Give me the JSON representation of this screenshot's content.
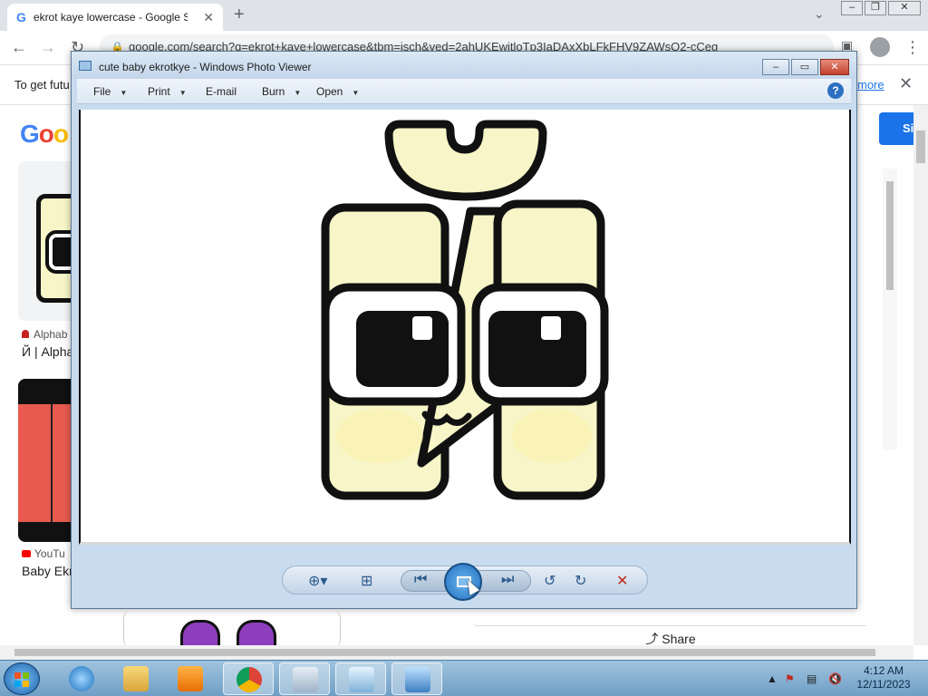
{
  "browser": {
    "tab_title": "ekrot kaye lowercase - Google Se",
    "tab_close": "✕",
    "new_tab": "+",
    "address": "google.com/search?q=ekrot+kaye+lowercase&tbm=isch&ved=2ahUKEwitloTp3IaDAxXbLFkFHV9ZAWsQ2-cCeg",
    "infobar_text": "To get futu",
    "infobar_more": "more",
    "signin": "Si"
  },
  "results": {
    "item1_source": "Alphab",
    "item1_title": "Й | Alpha",
    "item2_source": "YouTu",
    "item2_title": "Baby Ekr",
    "share": "Share"
  },
  "photo_viewer": {
    "title": "cute baby ekrotkye - Windows Photo Viewer",
    "menu": {
      "file": "File",
      "print": "Print",
      "email": "E-mail",
      "burn": "Burn",
      "open": "Open"
    },
    "help": "?"
  },
  "taskbar": {
    "time": "4:12 AM",
    "date": "12/11/2023"
  },
  "colors": {
    "letter_fill": "#f8f6c8",
    "letter_outline": "#111111",
    "chrome_blue": "#1a73e8"
  }
}
